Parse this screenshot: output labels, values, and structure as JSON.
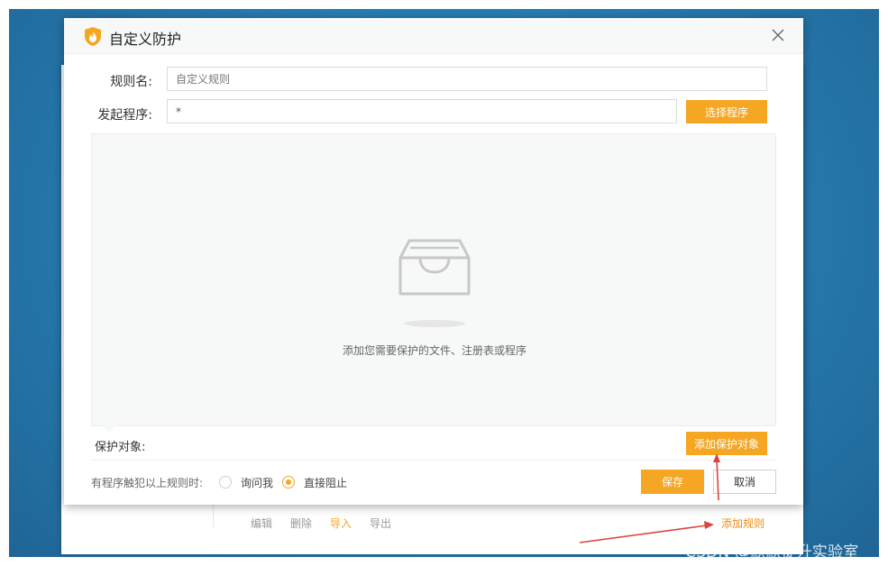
{
  "dialog": {
    "title": "自定义防护",
    "rule_name_label": "规则名:",
    "rule_name_placeholder": "自定义规则",
    "program_label": "发起程序:",
    "program_value": "*",
    "select_program_button": "选择程序",
    "empty_text": "添加您需要保护的文件、注册表或程序",
    "protect_target_label": "保护对象:",
    "add_protect_button": "添加保护对象",
    "trigger_label": "有程序触犯以上规则时:",
    "option_ask": "询问我",
    "option_block": "直接阻止",
    "selected_option": "直接阻止",
    "save_button": "保存",
    "cancel_button": "取消"
  },
  "background_panel": {
    "actions": [
      "编辑",
      "删除",
      "导入",
      "导出"
    ],
    "add_rule": "添加规则"
  },
  "watermark": "CSDN @默默提升实验室",
  "colors": {
    "accent": "#f5a623",
    "desktop": "#2677ab",
    "annotation_arrow": "#d9453b"
  },
  "icons": [
    "shield-flame-icon",
    "close-icon",
    "empty-tray-icon"
  ]
}
